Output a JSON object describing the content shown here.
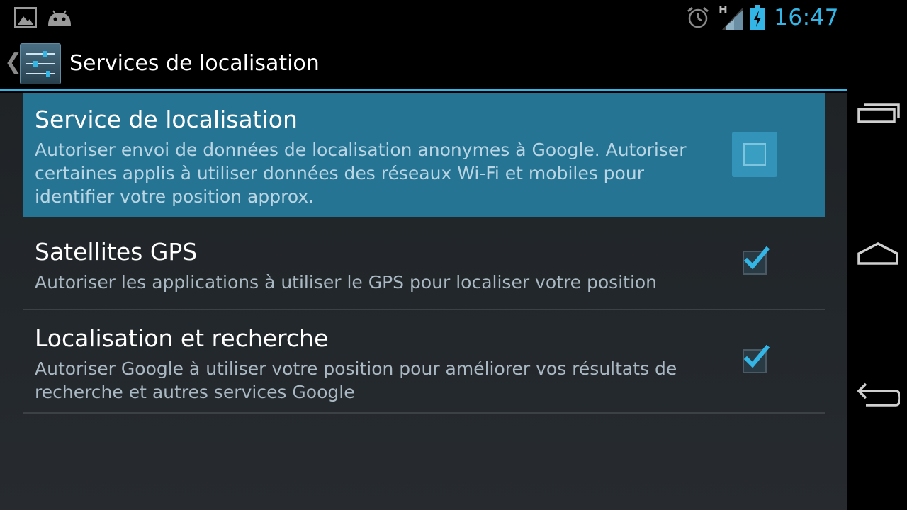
{
  "status_bar": {
    "clock": "16:47",
    "network_type": "H",
    "icons": [
      "gallery-icon",
      "android-icon",
      "alarm-icon",
      "signal-icon",
      "battery-charging-icon"
    ]
  },
  "action_bar": {
    "title": "Services de localisation",
    "icon": "settings-icon"
  },
  "preferences": [
    {
      "title": "Service de localisation",
      "summary_lines": [
        "Autoriser envoi de données de localisation anonymes à Google. Autoriser",
        "certaines applis à utiliser données des réseaux Wi-Fi et mobiles pour",
        "identifier votre position approx."
      ],
      "checked": false,
      "highlighted": true
    },
    {
      "title": "Satellites GPS",
      "summary_lines": [
        "Autoriser les applications à utiliser le GPS pour localiser votre position"
      ],
      "checked": true,
      "highlighted": false
    },
    {
      "title": "Localisation et recherche",
      "summary_lines": [
        "Autoriser Google à utiliser votre position pour améliorer vos résultats de",
        "recherche et autres services Google"
      ],
      "checked": true,
      "highlighted": false
    }
  ],
  "nav_bar": {
    "buttons": [
      "recent-apps",
      "home",
      "back"
    ]
  },
  "colors": {
    "accent": "#33b5e5",
    "highlight": "#257494",
    "background": "#23282c"
  }
}
